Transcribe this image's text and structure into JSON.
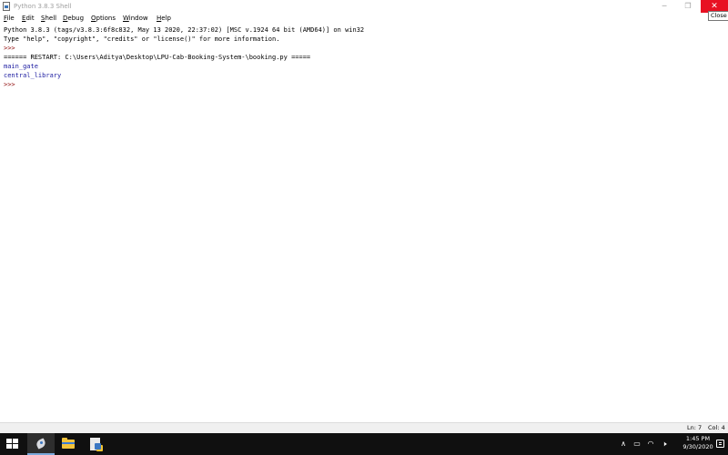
{
  "window": {
    "title": "Python 3.8.3 Shell",
    "minimize_glyph": "─",
    "maximize_glyph": "❐",
    "close_glyph": "✕",
    "close_tooltip": "Close",
    "accent_close": "#e81123"
  },
  "menu": {
    "items": [
      {
        "mnemonic": "F",
        "rest": "ile"
      },
      {
        "mnemonic": "E",
        "rest": "dit"
      },
      {
        "mnemonic": "S",
        "rest": "hell"
      },
      {
        "mnemonic": "D",
        "rest": "ebug"
      },
      {
        "mnemonic": "O",
        "rest": "ptions"
      },
      {
        "mnemonic": "W",
        "rest": "indow"
      },
      {
        "mnemonic": "H",
        "rest": "elp"
      }
    ]
  },
  "shell": {
    "lines": [
      "Python 3.8.3 (tags/v3.8.3:6f8c832, May 13 2020, 22:37:02) [MSC v.1924 64 bit (AMD64)] on win32",
      "Type \"help\", \"copyright\", \"credits\" or \"license()\" for more information.",
      ">>> ",
      "====== RESTART: C:\\Users\\Aditya\\Desktop\\LPU-Cab-Booking-System-\\booking.py =====",
      "main_gate",
      "central_library",
      ">>> "
    ],
    "colors": {
      "output": "#000000",
      "prompt": "#8b0000",
      "result": "#1a1aa0"
    }
  },
  "status": {
    "line": "Ln: 7",
    "col": "Col: 4"
  },
  "taskbar": {
    "icons": [
      "windows-start-icon",
      "python-idle-icon",
      "file-explorer-icon",
      "python-file-icon"
    ],
    "tray": {
      "chevron": "∧",
      "battery": "▭",
      "wifi": "◠",
      "volume": "🕨",
      "time": "1:45 PM",
      "date": "9/30/2020"
    }
  }
}
